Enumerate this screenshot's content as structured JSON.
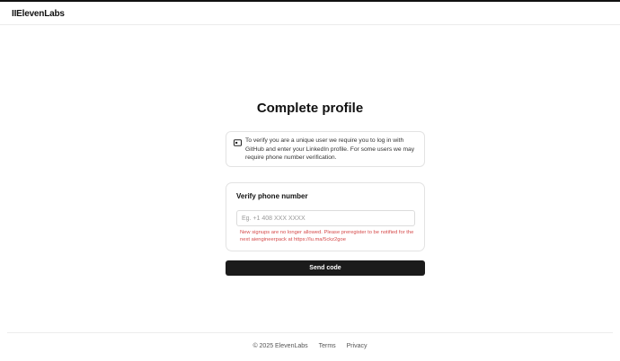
{
  "header": {
    "logo": "IIElevenLabs"
  },
  "page": {
    "title": "Complete profile"
  },
  "info": {
    "icon": "id-card-icon",
    "text": "To verify you are a unique user we require you to log in with GitHub and enter your LinkedIn profile. For some users we may require phone number verification."
  },
  "phone": {
    "title": "Verify phone number",
    "placeholder": "Eg. +1 408 XXX XXXX",
    "value": "",
    "error": "New signups are no longer allowed. Please preregister to be notified for the next aiengineerpack at https://lu.ma/5ckz2goe"
  },
  "actions": {
    "send_code": "Send code"
  },
  "footer": {
    "copyright": "© 2025 ElevenLabs",
    "links": [
      "Terms",
      "Privacy"
    ]
  },
  "colors": {
    "error": "#d64b4b",
    "button": "#1b1b1b"
  }
}
